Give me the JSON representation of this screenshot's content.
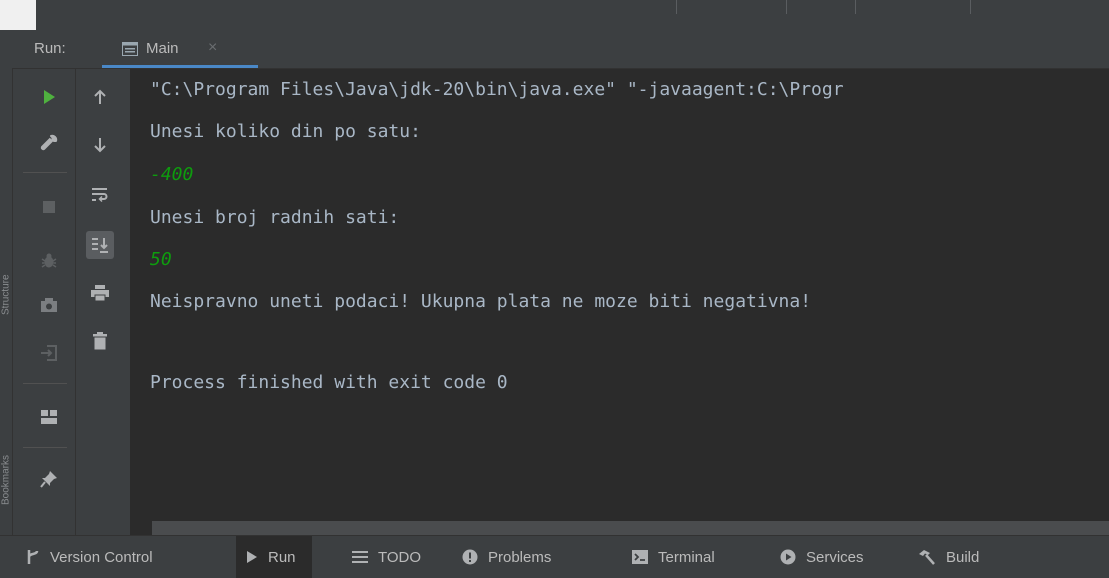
{
  "run_panel": {
    "label": "Run:",
    "tab_title": "Main",
    "tab_close": "×"
  },
  "gutter": {
    "structure_label": "Structure",
    "bookmarks_label": "Bookmarks"
  },
  "console": {
    "lines": [
      "\"C:\\Program Files\\Java\\jdk-20\\bin\\java.exe\" \"-javaagent:C:\\Progr",
      "Unesi koliko din po satu:",
      "-400",
      "Unesi broj radnih sati:",
      "50",
      "Neispravno uneti podaci! Ukupna plata ne moze biti negativna!",
      "",
      "Process finished with exit code 0"
    ]
  },
  "statusbar": {
    "version_control": "Version Control",
    "run": "Run",
    "todo": "TODO",
    "problems": "Problems",
    "terminal": "Terminal",
    "services": "Services",
    "build": "Build"
  },
  "colors": {
    "background": "#2b2b2b",
    "panel": "#3c3f41",
    "console_text": "#a9b7c6",
    "user_input": "#0e9c0e",
    "accent": "#4a88c7",
    "run_green": "#4fb13f"
  }
}
